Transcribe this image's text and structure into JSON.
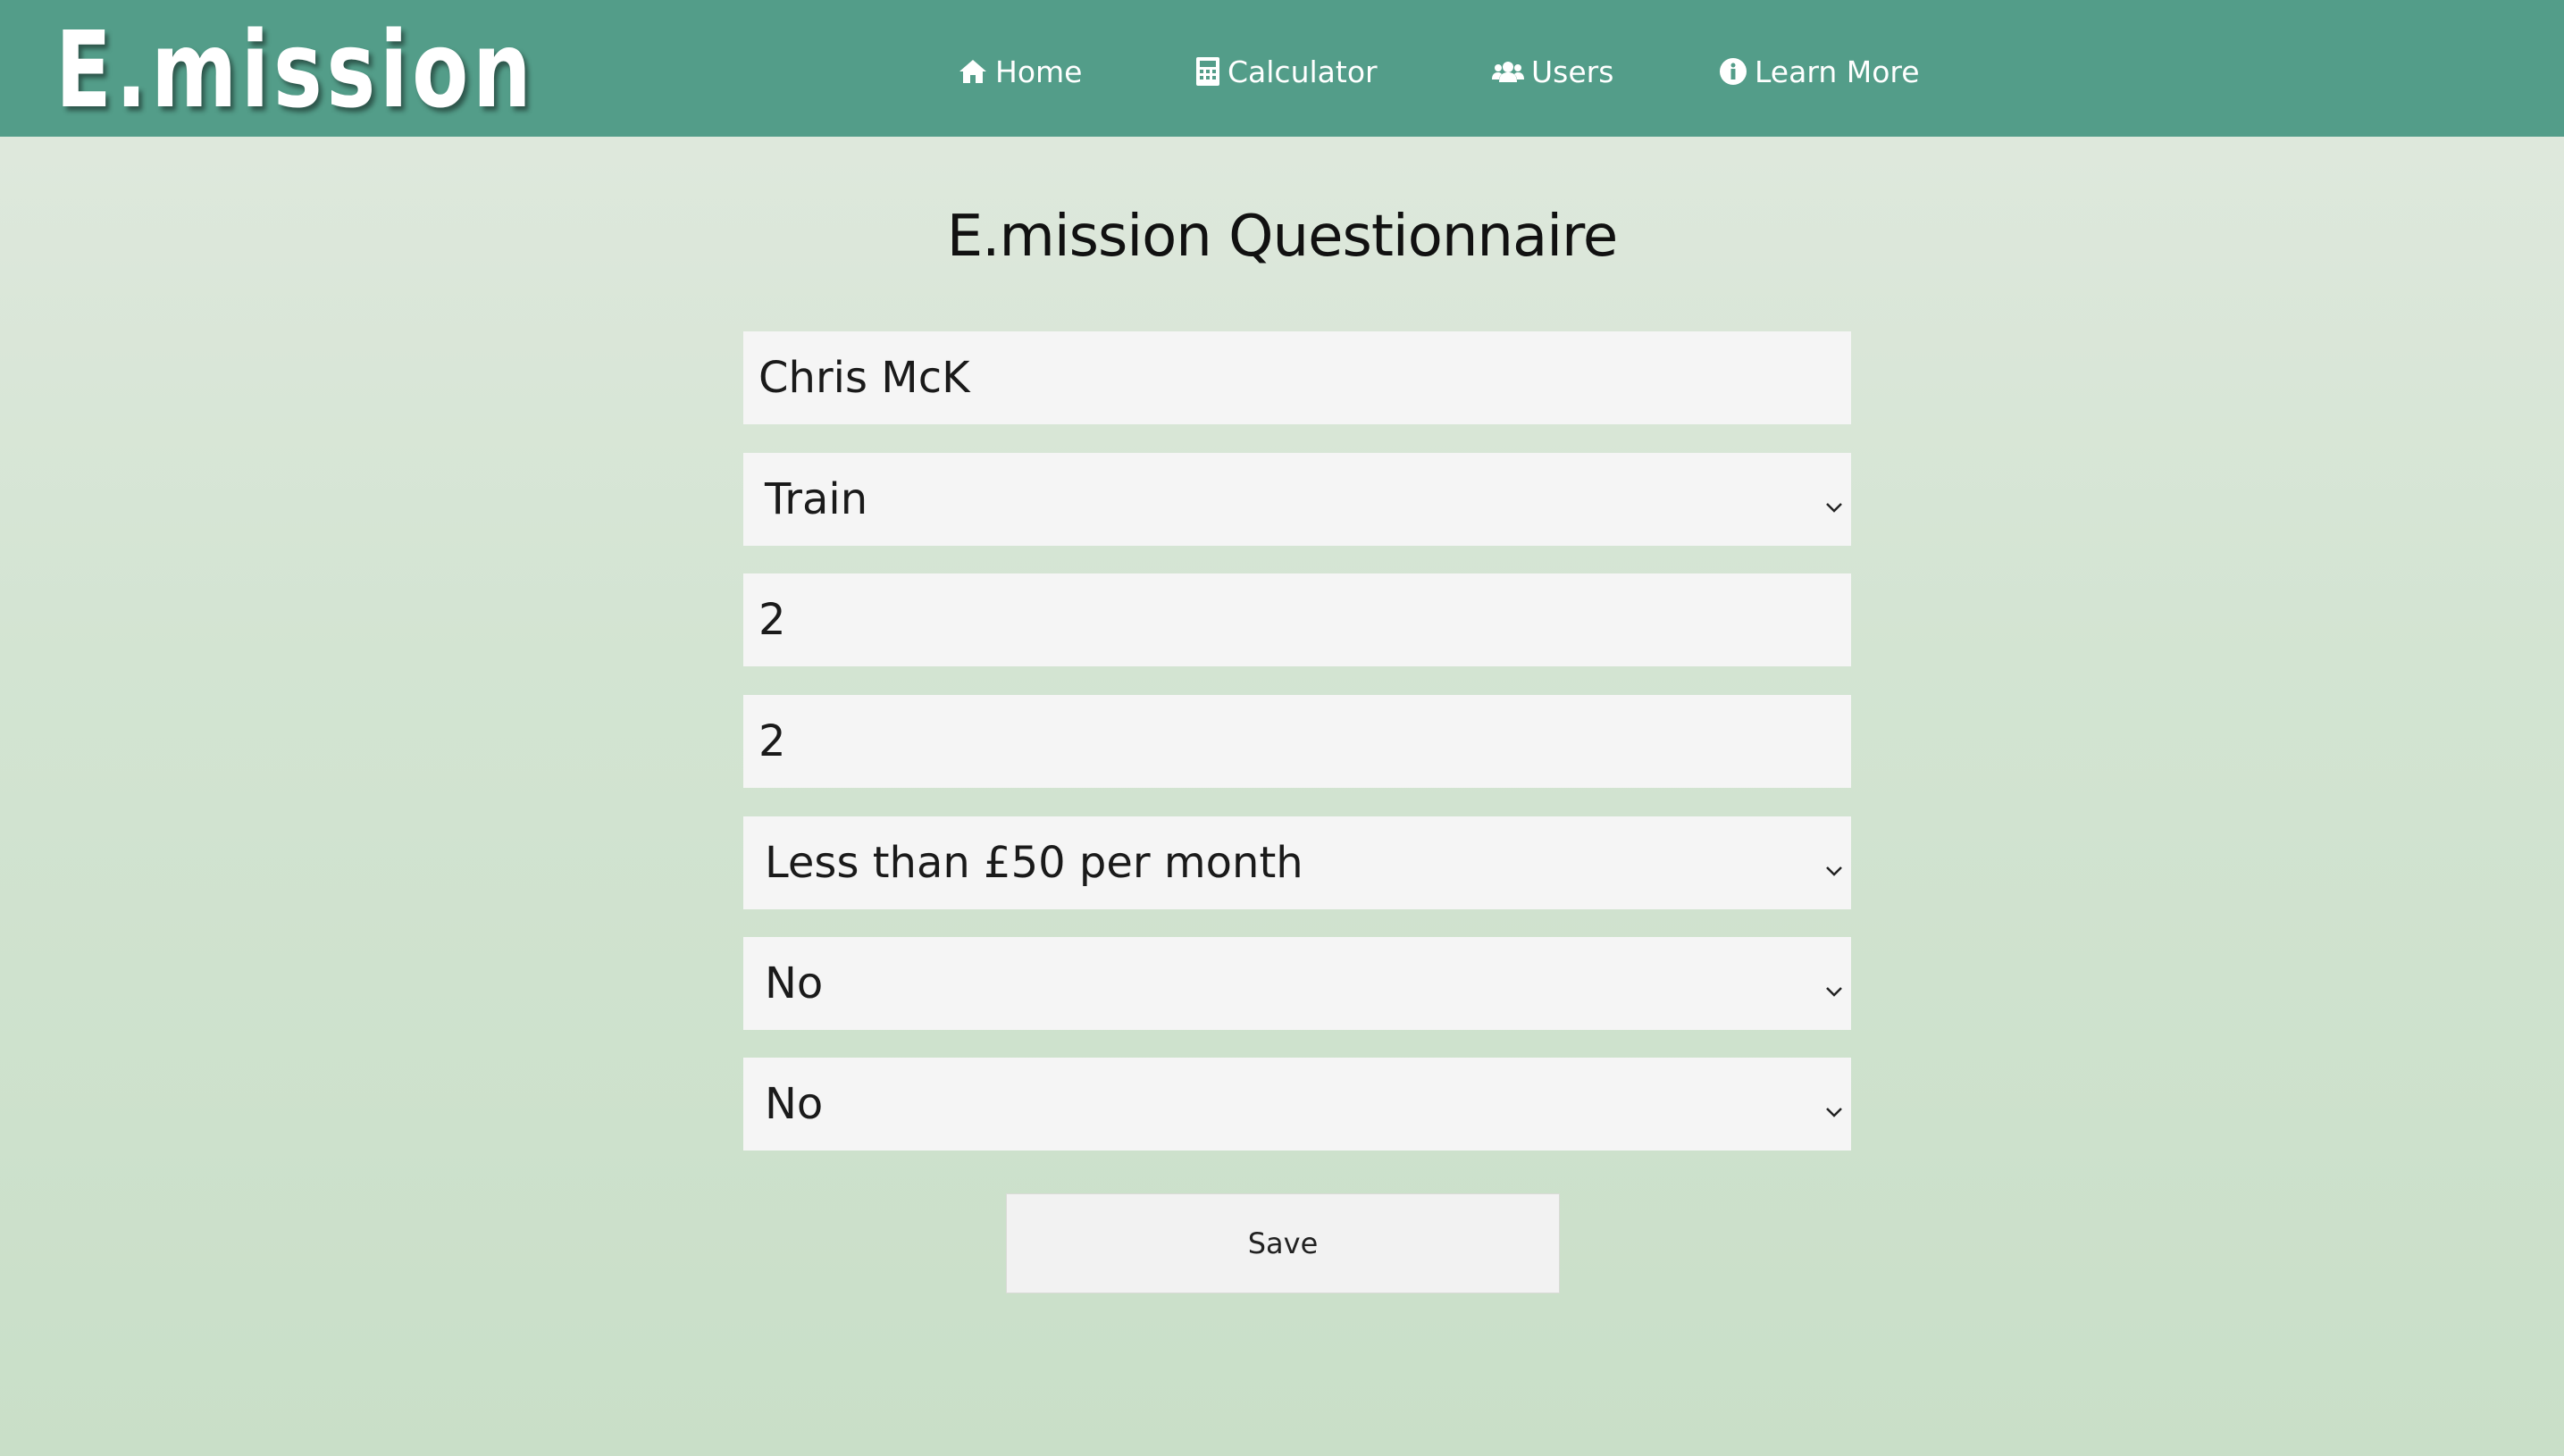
{
  "app": {
    "logo_text": "E.mission"
  },
  "nav": {
    "items": [
      {
        "label": "Home",
        "icon": "home-icon"
      },
      {
        "label": "Calculator",
        "icon": "calculator-icon"
      },
      {
        "label": "Users",
        "icon": "users-icon"
      },
      {
        "label": "Learn More",
        "icon": "info-circle-icon"
      }
    ]
  },
  "colors": {
    "navbar": "#539d89",
    "background_top": "#e1e9df",
    "background_bottom": "#c9dfc8",
    "field": "#f5f5f5"
  },
  "form": {
    "title": "E.mission Questionnaire",
    "name_value": "Chris McK",
    "transport_selected": "Train",
    "field3_value": "2",
    "field4_value": "2",
    "spend_selected": "Less than £50 per month",
    "question6_selected": "No",
    "question7_selected": "No",
    "save_label": "Save"
  }
}
